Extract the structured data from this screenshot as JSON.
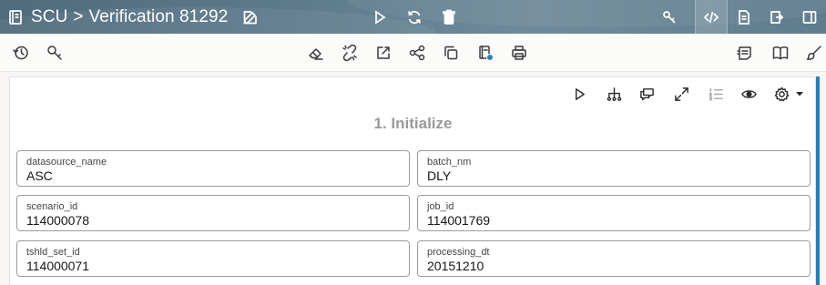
{
  "header": {
    "app_name": "SCU",
    "separator": ">",
    "title": "Verification 81292"
  },
  "toolbar": {
    "tools": [
      "history-icon",
      "key-search-icon",
      "eraser-icon",
      "unlink-icon",
      "export-icon",
      "share-icon",
      "copy-icon",
      "notebook-icon",
      "print-icon",
      "list-edit-icon",
      "book-icon",
      "brush-icon"
    ]
  },
  "panel": {
    "section_title": "1. Initialize",
    "fields": [
      {
        "label": "datasource_name",
        "value": "ASC"
      },
      {
        "label": "batch_nm",
        "value": "DLY"
      },
      {
        "label": "scenario_id",
        "value": "114000078"
      },
      {
        "label": "job_id",
        "value": "114001769"
      },
      {
        "label": "tshld_set_id",
        "value": "114000071"
      },
      {
        "label": "processing_dt",
        "value": "20151210"
      }
    ]
  },
  "colors": {
    "header_bg": "#5d7a8b",
    "accent": "#2f7fae",
    "section_title": "#9a9a9a"
  }
}
